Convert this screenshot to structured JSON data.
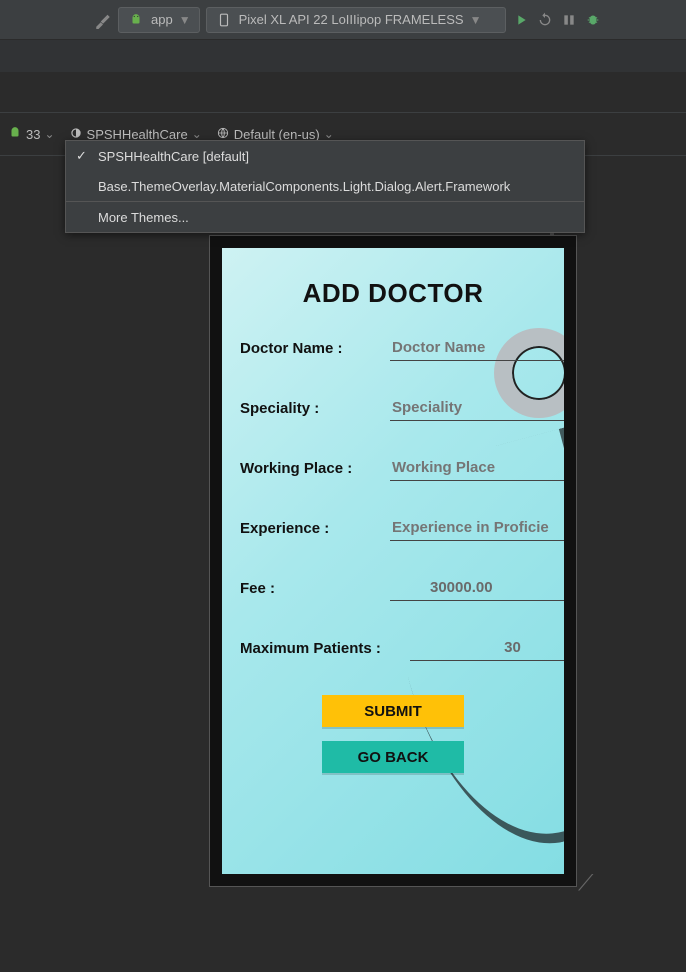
{
  "toolbar": {
    "app_config_label": "app",
    "device_label": "Pixel XL API 22 LoIIIipop FRAMELESS"
  },
  "designbar": {
    "api_level": "33",
    "theme_selector": "SPSHHealthCare",
    "locale_selector": "Default (en-us)"
  },
  "dropdown": {
    "items": [
      {
        "label": "SPSHHealthCare [default]",
        "checked": true
      },
      {
        "label": "Base.ThemeOverlay.MaterialComponents.Light.Dialog.Alert.Framework",
        "checked": false
      },
      {
        "label": "More Themes...",
        "checked": false
      }
    ]
  },
  "form": {
    "title": "ADD DOCTOR",
    "fields": {
      "doctor_name": {
        "label": "Doctor Name :",
        "placeholder": "Doctor Name",
        "value": ""
      },
      "speciality": {
        "label": "Speciality :",
        "placeholder": "Speciality",
        "value": ""
      },
      "working_place": {
        "label": "Working Place :",
        "placeholder": "Working Place",
        "value": ""
      },
      "experience": {
        "label": "Experience :",
        "placeholder": "Experience in Proficie",
        "value": ""
      },
      "fee": {
        "label": "Fee :",
        "placeholder": "",
        "value": "30000.00"
      },
      "max_patients": {
        "label": "Maximum Patients :",
        "placeholder": "",
        "value": "30"
      }
    },
    "buttons": {
      "submit": "SUBMIT",
      "go_back": "GO BACK"
    }
  }
}
